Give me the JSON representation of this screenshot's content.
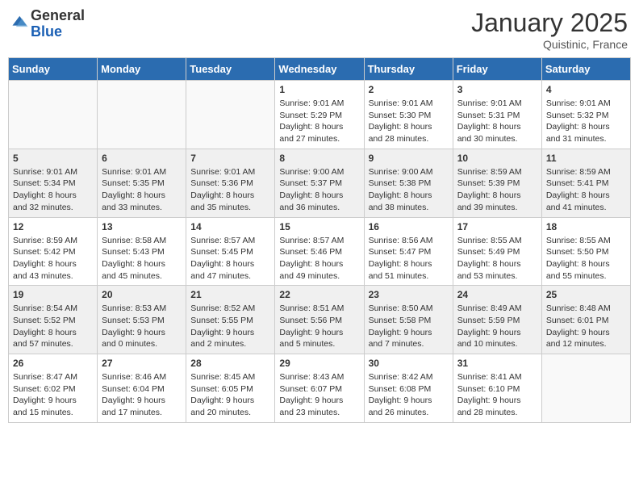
{
  "header": {
    "logo_general": "General",
    "logo_blue": "Blue",
    "month": "January 2025",
    "location": "Quistinic, France"
  },
  "days_of_week": [
    "Sunday",
    "Monday",
    "Tuesday",
    "Wednesday",
    "Thursday",
    "Friday",
    "Saturday"
  ],
  "weeks": [
    {
      "shaded": false,
      "days": [
        {
          "num": "",
          "info": ""
        },
        {
          "num": "",
          "info": ""
        },
        {
          "num": "",
          "info": ""
        },
        {
          "num": "1",
          "info": "Sunrise: 9:01 AM\nSunset: 5:29 PM\nDaylight: 8 hours and 27 minutes."
        },
        {
          "num": "2",
          "info": "Sunrise: 9:01 AM\nSunset: 5:30 PM\nDaylight: 8 hours and 28 minutes."
        },
        {
          "num": "3",
          "info": "Sunrise: 9:01 AM\nSunset: 5:31 PM\nDaylight: 8 hours and 30 minutes."
        },
        {
          "num": "4",
          "info": "Sunrise: 9:01 AM\nSunset: 5:32 PM\nDaylight: 8 hours and 31 minutes."
        }
      ]
    },
    {
      "shaded": true,
      "days": [
        {
          "num": "5",
          "info": "Sunrise: 9:01 AM\nSunset: 5:34 PM\nDaylight: 8 hours and 32 minutes."
        },
        {
          "num": "6",
          "info": "Sunrise: 9:01 AM\nSunset: 5:35 PM\nDaylight: 8 hours and 33 minutes."
        },
        {
          "num": "7",
          "info": "Sunrise: 9:01 AM\nSunset: 5:36 PM\nDaylight: 8 hours and 35 minutes."
        },
        {
          "num": "8",
          "info": "Sunrise: 9:00 AM\nSunset: 5:37 PM\nDaylight: 8 hours and 36 minutes."
        },
        {
          "num": "9",
          "info": "Sunrise: 9:00 AM\nSunset: 5:38 PM\nDaylight: 8 hours and 38 minutes."
        },
        {
          "num": "10",
          "info": "Sunrise: 8:59 AM\nSunset: 5:39 PM\nDaylight: 8 hours and 39 minutes."
        },
        {
          "num": "11",
          "info": "Sunrise: 8:59 AM\nSunset: 5:41 PM\nDaylight: 8 hours and 41 minutes."
        }
      ]
    },
    {
      "shaded": false,
      "days": [
        {
          "num": "12",
          "info": "Sunrise: 8:59 AM\nSunset: 5:42 PM\nDaylight: 8 hours and 43 minutes."
        },
        {
          "num": "13",
          "info": "Sunrise: 8:58 AM\nSunset: 5:43 PM\nDaylight: 8 hours and 45 minutes."
        },
        {
          "num": "14",
          "info": "Sunrise: 8:57 AM\nSunset: 5:45 PM\nDaylight: 8 hours and 47 minutes."
        },
        {
          "num": "15",
          "info": "Sunrise: 8:57 AM\nSunset: 5:46 PM\nDaylight: 8 hours and 49 minutes."
        },
        {
          "num": "16",
          "info": "Sunrise: 8:56 AM\nSunset: 5:47 PM\nDaylight: 8 hours and 51 minutes."
        },
        {
          "num": "17",
          "info": "Sunrise: 8:55 AM\nSunset: 5:49 PM\nDaylight: 8 hours and 53 minutes."
        },
        {
          "num": "18",
          "info": "Sunrise: 8:55 AM\nSunset: 5:50 PM\nDaylight: 8 hours and 55 minutes."
        }
      ]
    },
    {
      "shaded": true,
      "days": [
        {
          "num": "19",
          "info": "Sunrise: 8:54 AM\nSunset: 5:52 PM\nDaylight: 8 hours and 57 minutes."
        },
        {
          "num": "20",
          "info": "Sunrise: 8:53 AM\nSunset: 5:53 PM\nDaylight: 9 hours and 0 minutes."
        },
        {
          "num": "21",
          "info": "Sunrise: 8:52 AM\nSunset: 5:55 PM\nDaylight: 9 hours and 2 minutes."
        },
        {
          "num": "22",
          "info": "Sunrise: 8:51 AM\nSunset: 5:56 PM\nDaylight: 9 hours and 5 minutes."
        },
        {
          "num": "23",
          "info": "Sunrise: 8:50 AM\nSunset: 5:58 PM\nDaylight: 9 hours and 7 minutes."
        },
        {
          "num": "24",
          "info": "Sunrise: 8:49 AM\nSunset: 5:59 PM\nDaylight: 9 hours and 10 minutes."
        },
        {
          "num": "25",
          "info": "Sunrise: 8:48 AM\nSunset: 6:01 PM\nDaylight: 9 hours and 12 minutes."
        }
      ]
    },
    {
      "shaded": false,
      "days": [
        {
          "num": "26",
          "info": "Sunrise: 8:47 AM\nSunset: 6:02 PM\nDaylight: 9 hours and 15 minutes."
        },
        {
          "num": "27",
          "info": "Sunrise: 8:46 AM\nSunset: 6:04 PM\nDaylight: 9 hours and 17 minutes."
        },
        {
          "num": "28",
          "info": "Sunrise: 8:45 AM\nSunset: 6:05 PM\nDaylight: 9 hours and 20 minutes."
        },
        {
          "num": "29",
          "info": "Sunrise: 8:43 AM\nSunset: 6:07 PM\nDaylight: 9 hours and 23 minutes."
        },
        {
          "num": "30",
          "info": "Sunrise: 8:42 AM\nSunset: 6:08 PM\nDaylight: 9 hours and 26 minutes."
        },
        {
          "num": "31",
          "info": "Sunrise: 8:41 AM\nSunset: 6:10 PM\nDaylight: 9 hours and 28 minutes."
        },
        {
          "num": "",
          "info": ""
        }
      ]
    }
  ]
}
